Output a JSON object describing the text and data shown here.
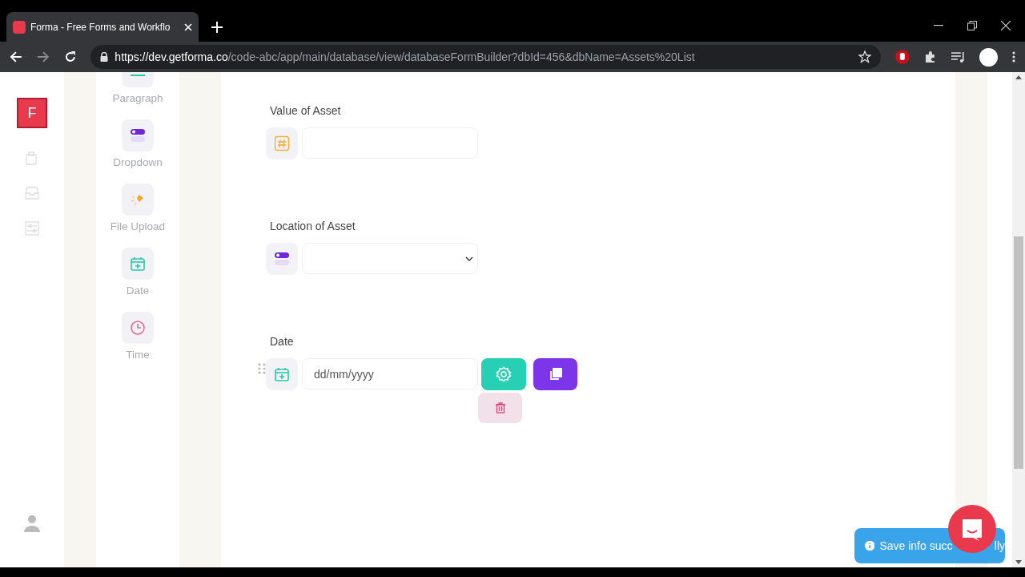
{
  "browser": {
    "tab_title": "Forma - Free Forms and Workflo",
    "url_host": "https://dev.getforma.co",
    "url_path": "/code-abc/app/main/database/view/databaseFormBuilder?dbId=456&dbName=Assets%20List"
  },
  "logo": "F",
  "palette": [
    {
      "label": "Paragraph",
      "kind": "paragraph"
    },
    {
      "label": "Dropdown",
      "kind": "dropdown"
    },
    {
      "label": "File Upload",
      "kind": "file_upload"
    },
    {
      "label": "Date",
      "kind": "date"
    },
    {
      "label": "Time",
      "kind": "time"
    }
  ],
  "fields": [
    {
      "label": "Value of Asset",
      "kind": "number",
      "selected": false
    },
    {
      "label": "Location of Asset",
      "kind": "dropdown",
      "selected": false
    },
    {
      "label": "Date",
      "kind": "date",
      "placeholder": "dd/mm/yyyy",
      "selected": true
    }
  ],
  "toast": {
    "text_start": "Save info succ",
    "text_end": "lly"
  }
}
